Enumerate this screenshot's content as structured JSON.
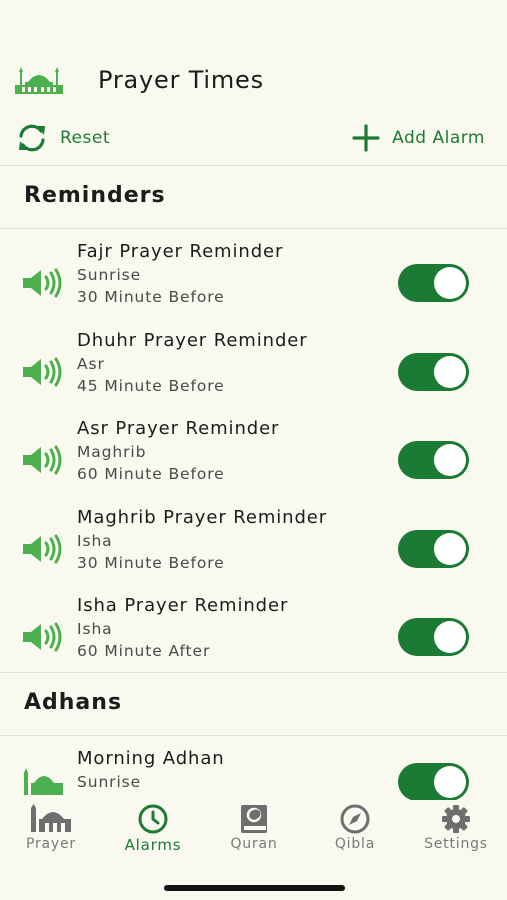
{
  "header": {
    "title": "Prayer Times"
  },
  "toolbar": {
    "reset_label": "Reset",
    "add_label": "Add Alarm"
  },
  "sections": {
    "reminders_title": "Reminders",
    "adhans_title": "Adhans"
  },
  "reminders": [
    {
      "title": "Fajr Prayer Reminder",
      "prayer": "Sunrise",
      "offset": "30 Minute Before",
      "enabled": true
    },
    {
      "title": "Dhuhr Prayer Reminder",
      "prayer": "Asr",
      "offset": "45 Minute Before",
      "enabled": true
    },
    {
      "title": "Asr Prayer Reminder",
      "prayer": "Maghrib",
      "offset": "60 Minute Before",
      "enabled": true
    },
    {
      "title": "Maghrib Prayer Reminder",
      "prayer": "Isha",
      "offset": "30 Minute Before",
      "enabled": true
    },
    {
      "title": "Isha Prayer Reminder",
      "prayer": "Isha",
      "offset": "60 Minute After",
      "enabled": true
    }
  ],
  "adhans": [
    {
      "title": "Morning Adhan",
      "prayer": "Sunrise",
      "enabled": true
    }
  ],
  "tabs": [
    {
      "label": "Prayer",
      "icon": "mosque-icon",
      "active": false
    },
    {
      "label": "Alarms",
      "icon": "clock-icon",
      "active": true
    },
    {
      "label": "Quran",
      "icon": "book-icon",
      "active": false
    },
    {
      "label": "Qibla",
      "icon": "compass-icon",
      "active": false
    },
    {
      "label": "Settings",
      "icon": "gear-icon",
      "active": false
    }
  ],
  "colors": {
    "accent": "#1d7a36",
    "toggle_on": "#1b7a33",
    "icon_green": "#4caf50",
    "background": "#f9f9f0"
  }
}
